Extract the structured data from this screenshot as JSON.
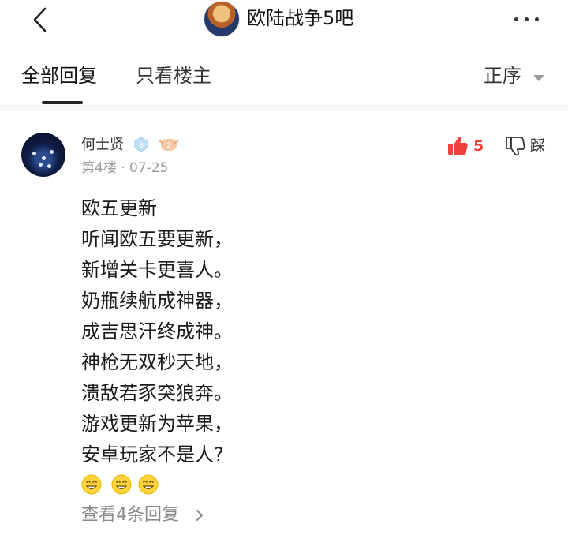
{
  "header": {
    "forum_title": "欧陆战争5吧",
    "back_icon": "chevron-left-icon",
    "more_icon": "more-dots-icon"
  },
  "tabs": {
    "items": [
      {
        "label": "全部回复",
        "active": true
      },
      {
        "label": "只看楼主",
        "active": false
      }
    ],
    "sort_label": "正序"
  },
  "post": {
    "username": "何士贤",
    "level_badge": "8",
    "fan_badge": "2",
    "floor": "第4楼",
    "separator": "·",
    "date": "07-25",
    "likes": "5",
    "dislike_label": "踩",
    "content_lines": [
      "欧五更新",
      "听闻欧五要更新，",
      "新增关卡更喜人。",
      "奶瓶续航成神器，",
      "成吉思汗终成神。",
      "神枪无双秒天地，",
      "溃敌若豕突狼奔。",
      "游戏更新为苹果，",
      "安卓玩家不是人?"
    ],
    "emojis": [
      "grin-emoji",
      "grin-emoji",
      "grin-emoji"
    ],
    "replies_link": "查看4条回复"
  },
  "colors": {
    "accent_red": "#f0423d",
    "meta_gray": "#9a9a9a",
    "text": "#1a1a1a"
  }
}
